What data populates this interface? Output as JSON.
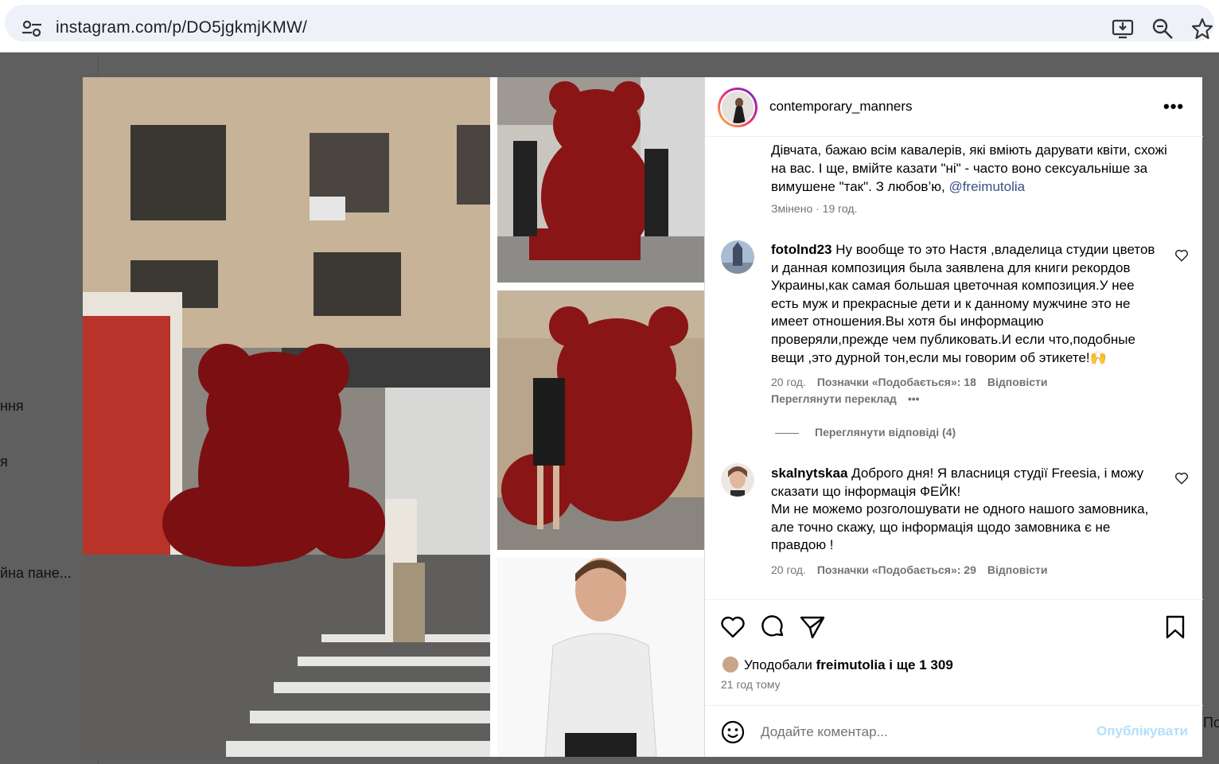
{
  "browser": {
    "url": "instagram.com/p/DO5jgkmjKMW/",
    "icons": [
      "tune-icon",
      "install-app-icon",
      "zoom-out-icon",
      "bookmark-star-icon"
    ]
  },
  "background_sidebar": {
    "items": [
      "ння",
      "я",
      "йна пане..."
    ]
  },
  "background_right_text": "По",
  "post": {
    "username": "contemporary_manners",
    "caption": {
      "text_before": "Дівчата, бажаю всім кавалерів, які вміють дарувати квіти, схожі на вас. І ще, вмійте казати \"ні\" - часто воно сексуальніше за вимушене \"так\". З любов’ю, ",
      "mention": "@freimutolia",
      "meta": "Змінено · 19 год."
    },
    "comments": [
      {
        "username": "fotolnd23",
        "text": "Ну вообще то это Настя ,владелица студии цветов и данная композиция была заявлена для книги рекордов Украины,как самая большая цветочная композиция.У нее есть муж и прекрасные дети и к данному мужчине это не имеет отношения.Вы хотя бы информацию проверяли,прежде чем публиковать.И если что,подобные вещи ,это дурной тон,если мы говорим об этикете!🙌",
        "time": "20 год.",
        "likes": "Позначки «Подобається»: 18",
        "reply": "Відповісти",
        "translate": "Переглянути переклад",
        "more": "•••",
        "view_replies": "Переглянути відповіді (4)"
      },
      {
        "username": "skalnytskaa",
        "text": "Доброго дня! Я власниця студії Freesia, і можу сказати що інформація ФЕЙК!\nМи не можемо розголошувати не одного нашого замовника, але точно скажу, що інформація щодо замовника є не правдою !",
        "time": "20 год.",
        "likes": "Позначки «Подобається»: 29",
        "reply": "Відповісти"
      }
    ],
    "liked_by_prefix": "Уподобали ",
    "liked_by_user": "freimutolia",
    "liked_by_suffix": " і ще 1 309",
    "time_ago": "21 год тому",
    "comment_placeholder": "Додайте коментар...",
    "publish_label": "Опублікувати"
  }
}
